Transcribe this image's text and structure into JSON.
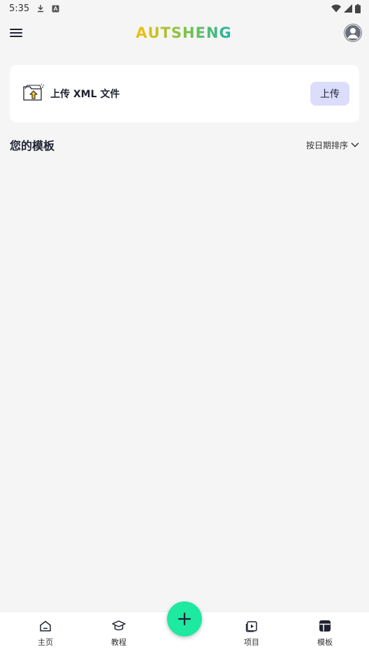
{
  "status_bar": {
    "time": "5:35"
  },
  "header": {
    "logo": {
      "first": "A",
      "rest": "UTSHENG"
    }
  },
  "upload_card": {
    "label": "上传 XML 文件",
    "button": "上传"
  },
  "templates_section": {
    "title": "您的模板",
    "sort_label": "按日期排序"
  },
  "bottom_nav": {
    "items": [
      {
        "label": "主页",
        "icon": "home-icon"
      },
      {
        "label": "教程",
        "icon": "graduation-cap-icon"
      },
      {
        "label": "项目",
        "icon": "video-project-icon"
      },
      {
        "label": "模板",
        "icon": "template-icon",
        "active": true
      }
    ]
  },
  "colors": {
    "fab": "#1de9a0",
    "upload_button_bg": "#dcdcfb",
    "logo_yellow": "#e6c21a",
    "logo_teal": "#22b3a8",
    "background": "#f5f5f5"
  }
}
